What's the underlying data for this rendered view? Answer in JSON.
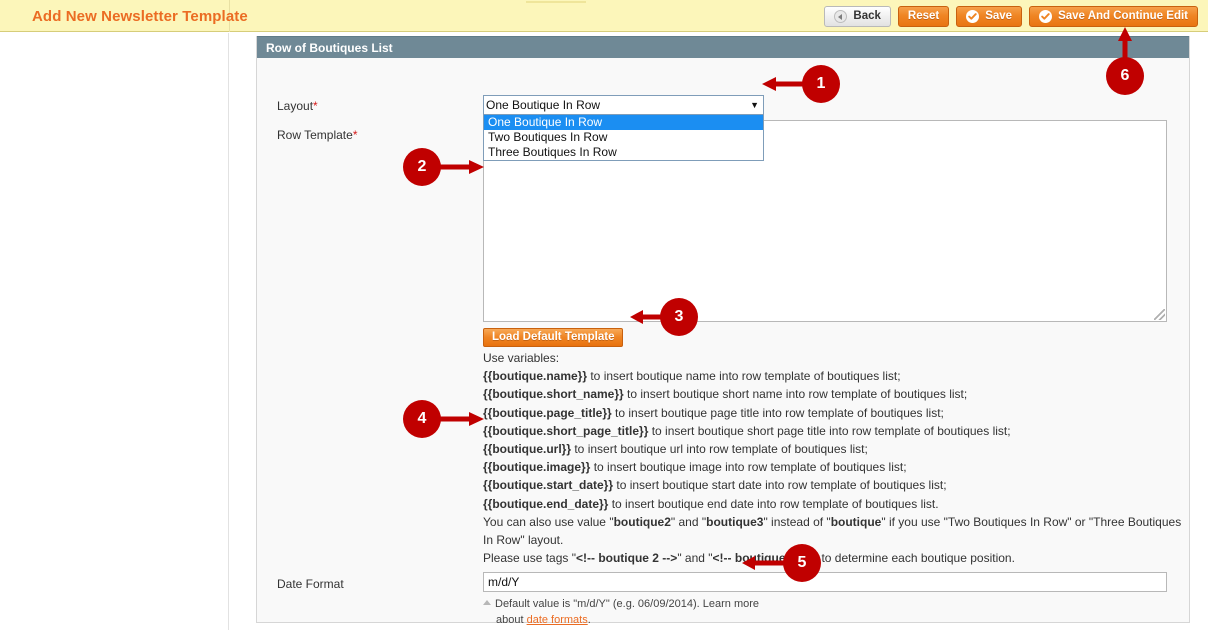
{
  "header": {
    "title": "Add New Newsletter Template",
    "buttons": [
      {
        "label": "Back",
        "icon": "back-circle-icon",
        "style": "grey"
      },
      {
        "label": "Reset",
        "icon": "none",
        "style": "orange"
      },
      {
        "label": "Save",
        "icon": "check-circle-icon",
        "style": "orange"
      },
      {
        "label": "Save And Continue Edit",
        "icon": "check-circle-icon",
        "style": "orange"
      }
    ]
  },
  "panel": {
    "title": "Row of Boutiques List",
    "layout_field": {
      "label": "Layout",
      "required_marker": "*",
      "selected": "One Boutique In Row",
      "options": [
        "One Boutique In Row",
        "Two Boutiques In Row",
        "Three Boutiques In Row"
      ],
      "dropdown_open": true,
      "arrow_glyph": "▼"
    },
    "row_template_field": {
      "label": "Row Template",
      "required_marker": "*",
      "value": "",
      "load_default_label": "Load Default Template"
    },
    "variables": {
      "intro": "Use variables:",
      "lines": [
        {
          "var": "{{boutique.name}}",
          "text": " to insert boutique name into row template of boutiques list;"
        },
        {
          "var": "{{boutique.short_name}}",
          "text": " to insert boutique short name into row template of boutiques list;"
        },
        {
          "var": "{{boutique.page_title}}",
          "text": " to insert boutique page title into row template of boutiques list;"
        },
        {
          "var": "{{boutique.short_page_title}}",
          "text": " to insert boutique short page title into row template of boutiques list;"
        },
        {
          "var": "{{boutique.url}}",
          "text": " to insert boutique url into row template of boutiques list;"
        },
        {
          "var": "{{boutique.image}}",
          "text": " to insert boutique image into row template of boutiques list;"
        },
        {
          "var": "{{boutique.start_date}}",
          "text": " to insert boutique start date into row template of boutiques list;"
        },
        {
          "var": "{{boutique.end_date}}",
          "text": " to insert boutique end date into row template of boutiques list."
        }
      ],
      "note_alt_1": "You can also use value \"",
      "note_alt_b1": "boutique2",
      "note_alt_2": "\" and \"",
      "note_alt_b2": "boutique3",
      "note_alt_3": "\" instead of \"",
      "note_alt_b3": "boutique",
      "note_alt_4": "\" if you use \"Two Boutiques In Row\" or \"Three Boutiques In Row\" layout.",
      "note_tags_1": "Please use tags \"",
      "note_tags_b1": "<!-- boutique 2 -->",
      "note_tags_2": "\" and \"",
      "note_tags_b2": "<!-- boutique 3 -->",
      "note_tags_3": "\" to determine each boutique position."
    },
    "date_format_field": {
      "label": "Date Format",
      "value": "m/d/Y",
      "note_line1": "Default value is \"m/d/Y\" (e.g. 06/09/2014). Learn more",
      "note_line2_prefix": "about ",
      "note_link": "date formats",
      "note_line2_suffix": "."
    }
  },
  "annotations": [
    {
      "number": "1",
      "direction": "left"
    },
    {
      "number": "2",
      "direction": "right"
    },
    {
      "number": "3",
      "direction": "left"
    },
    {
      "number": "4",
      "direction": "right"
    },
    {
      "number": "5",
      "direction": "left"
    },
    {
      "number": "6",
      "direction": "up"
    }
  ],
  "colors": {
    "accent_orange": "#eb6c23",
    "topbar_yellow": "#fcf6ba",
    "panel_head": "#6f8996",
    "marker_red": "#c00000",
    "select_highlight": "#1b8ef2"
  }
}
